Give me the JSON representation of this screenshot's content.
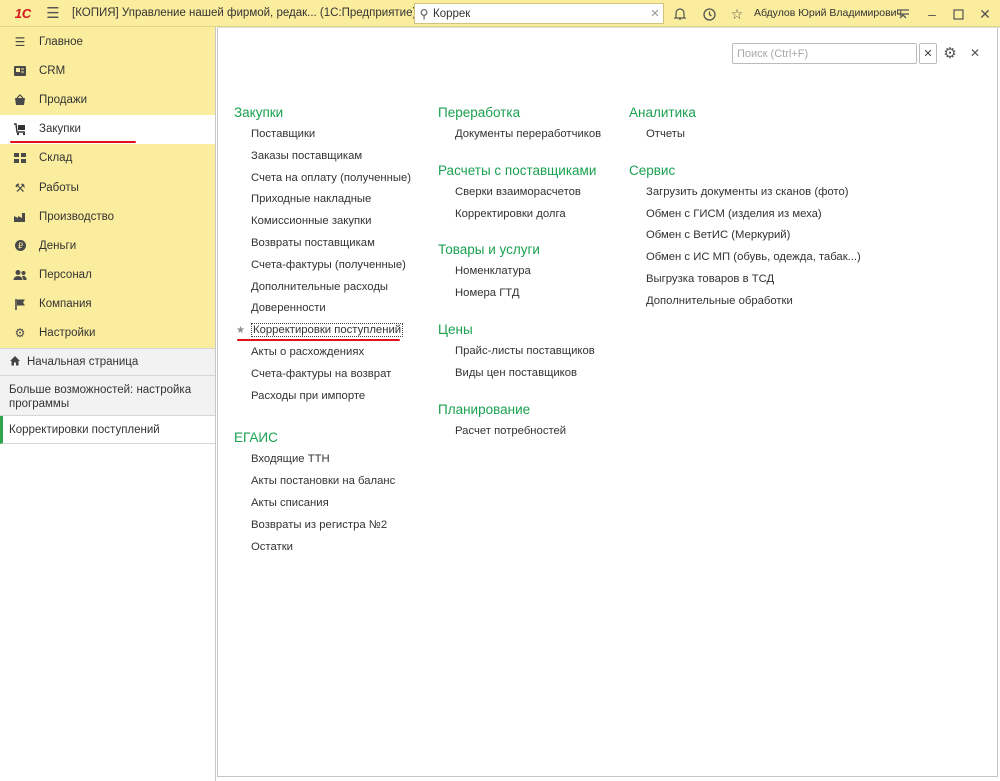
{
  "titlebar": {
    "logo": "1С",
    "title": "[КОПИЯ] Управление нашей фирмой, редак...   (1С:Предприятие)",
    "search_value": "Коррек",
    "user": "Абдулов Юрий Владимирович"
  },
  "sidebar": {
    "sections": [
      {
        "label": "Главное",
        "icon": "menu-lines-icon"
      },
      {
        "label": "CRM",
        "icon": "crm-card-icon"
      },
      {
        "label": "Продажи",
        "icon": "sales-basket-icon"
      },
      {
        "label": "Закупки",
        "icon": "purchases-cart-icon"
      },
      {
        "label": "Склад",
        "icon": "warehouse-grid-icon"
      },
      {
        "label": "Работы",
        "icon": "tools-icon"
      },
      {
        "label": "Производство",
        "icon": "factory-icon"
      },
      {
        "label": "Деньги",
        "icon": "money-coin-icon"
      },
      {
        "label": "Персонал",
        "icon": "staff-people-icon"
      },
      {
        "label": "Компания",
        "icon": "company-flag-icon"
      },
      {
        "label": "Настройки",
        "icon": "settings-gear-icon"
      }
    ],
    "home": "Начальная страница",
    "more": "Больше возможностей: настройка программы",
    "open_form": "Корректировки поступлений"
  },
  "main": {
    "search_placeholder": "Поиск (Ctrl+F)",
    "columns": [
      {
        "groups": [
          {
            "title": "Закупки",
            "items": [
              "Поставщики",
              "Заказы поставщикам",
              "Счета на оплату (полученные)",
              "Приходные накладные",
              "Комиссионные закупки",
              "Возвраты поставщикам",
              "Счета-фактуры (полученные)",
              "Дополнительные расходы",
              "Доверенности",
              "Корректировки поступлений",
              "Акты о расхождениях",
              "Счета-фактуры на возврат",
              "Расходы при импорте"
            ]
          },
          {
            "title": "ЕГАИС",
            "items": [
              "Входящие ТТН",
              "Акты постановки на баланс",
              "Акты списания",
              "Возвраты из регистра №2",
              "Остатки"
            ]
          }
        ]
      },
      {
        "groups": [
          {
            "title": "Переработка",
            "items": [
              "Документы переработчиков"
            ]
          },
          {
            "title": "Расчеты с поставщиками",
            "items": [
              "Сверки взаиморасчетов",
              "Корректировки долга"
            ]
          },
          {
            "title": "Товары и услуги",
            "items": [
              "Номенклатура",
              "Номера ГТД"
            ]
          },
          {
            "title": "Цены",
            "items": [
              "Прайс-листы поставщиков",
              "Виды цен поставщиков"
            ]
          },
          {
            "title": "Планирование",
            "items": [
              "Расчет потребностей"
            ]
          }
        ]
      },
      {
        "groups": [
          {
            "title": "Аналитика",
            "items": [
              "Отчеты"
            ]
          },
          {
            "title": "Сервис",
            "items": [
              "Загрузить документы из сканов (фото)",
              "Обмен с ГИСМ (изделия из меха)",
              "Обмен с ВетИС (Меркурий)",
              "Обмен с ИС МП (обувь, одежда, табак...)",
              "Выгрузка товаров в ТСД",
              "Дополнительные обработки"
            ]
          }
        ]
      }
    ]
  }
}
